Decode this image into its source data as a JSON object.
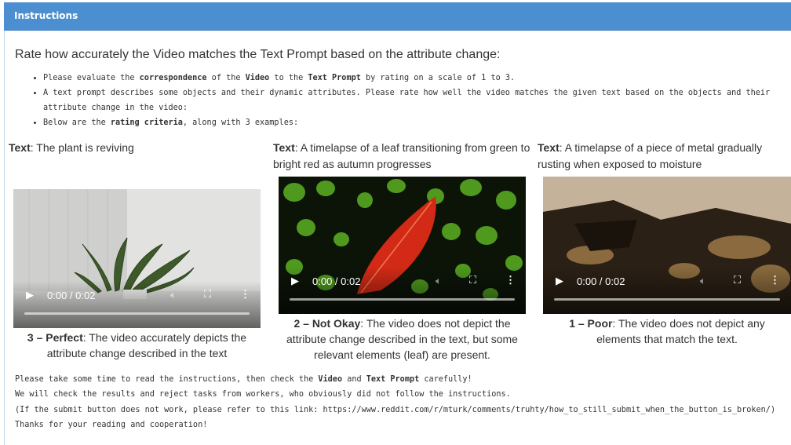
{
  "header": {
    "title": "Instructions"
  },
  "heading": "Rate how accurately the Video matches the Text Prompt based on the attribute change:",
  "bullets": {
    "b1": {
      "pre": "Please evaluate the ",
      "bold1": "correspondence",
      "mid1": " of the ",
      "bold2": "Video",
      "mid2": " to the ",
      "bold3": "Text Prompt",
      "post": " by rating on a scale of 1 to 3."
    },
    "b2": {
      "text": "A text prompt describes some objects and their dynamic attributes. Please rate how well the video matches the given text based on the objects and their attribute change in the video:"
    },
    "b3": {
      "pre": "Below are the ",
      "bold": "rating criteria",
      "post": ", along with 3 examples:"
    }
  },
  "examples": [
    {
      "label": "Text",
      "prompt": ": The plant is reviving",
      "time": "0:00 / 0:02",
      "rating": "3 – Perfect",
      "description": ": The video accurately depicts the attribute change described in the text"
    },
    {
      "label": "Text",
      "prompt": ": A timelapse of a leaf transitioning from green to bright red as autumn progresses",
      "time": "0:00 / 0:02",
      "rating": "2 – Not Okay",
      "description": ": The video does not depict the attribute change described in the text, but some relevant elements (leaf) are present."
    },
    {
      "label": "Text",
      "prompt": ": A timelapse of a piece of metal gradually rusting when exposed to moisture",
      "time": "0:00 / 0:02",
      "rating": "1 – Poor",
      "description": ": The video does not depict any elements that match the text."
    }
  ],
  "footer": {
    "line1": {
      "pre": "Please take some time to read the instructions, then check the ",
      "bold1": "Video",
      "mid": " and ",
      "bold2": "Text Prompt",
      "post": " carefully!"
    },
    "line2": "We will check the results and reject tasks from workers, who obviously did not follow the instructions.",
    "line3": "(If the submit button does not work, please refer to this link: https://www.reddit.com/r/mturk/comments/truhty/how_to_still_submit_when_the_button_is_broken/)",
    "line4": "Thanks for your reading and cooperation!"
  },
  "video_icons": [
    "play-icon",
    "volume-icon",
    "fullscreen-icon",
    "more-options-icon"
  ],
  "colors": {
    "header_bg": "#4b8fd1",
    "text": "#333333"
  }
}
